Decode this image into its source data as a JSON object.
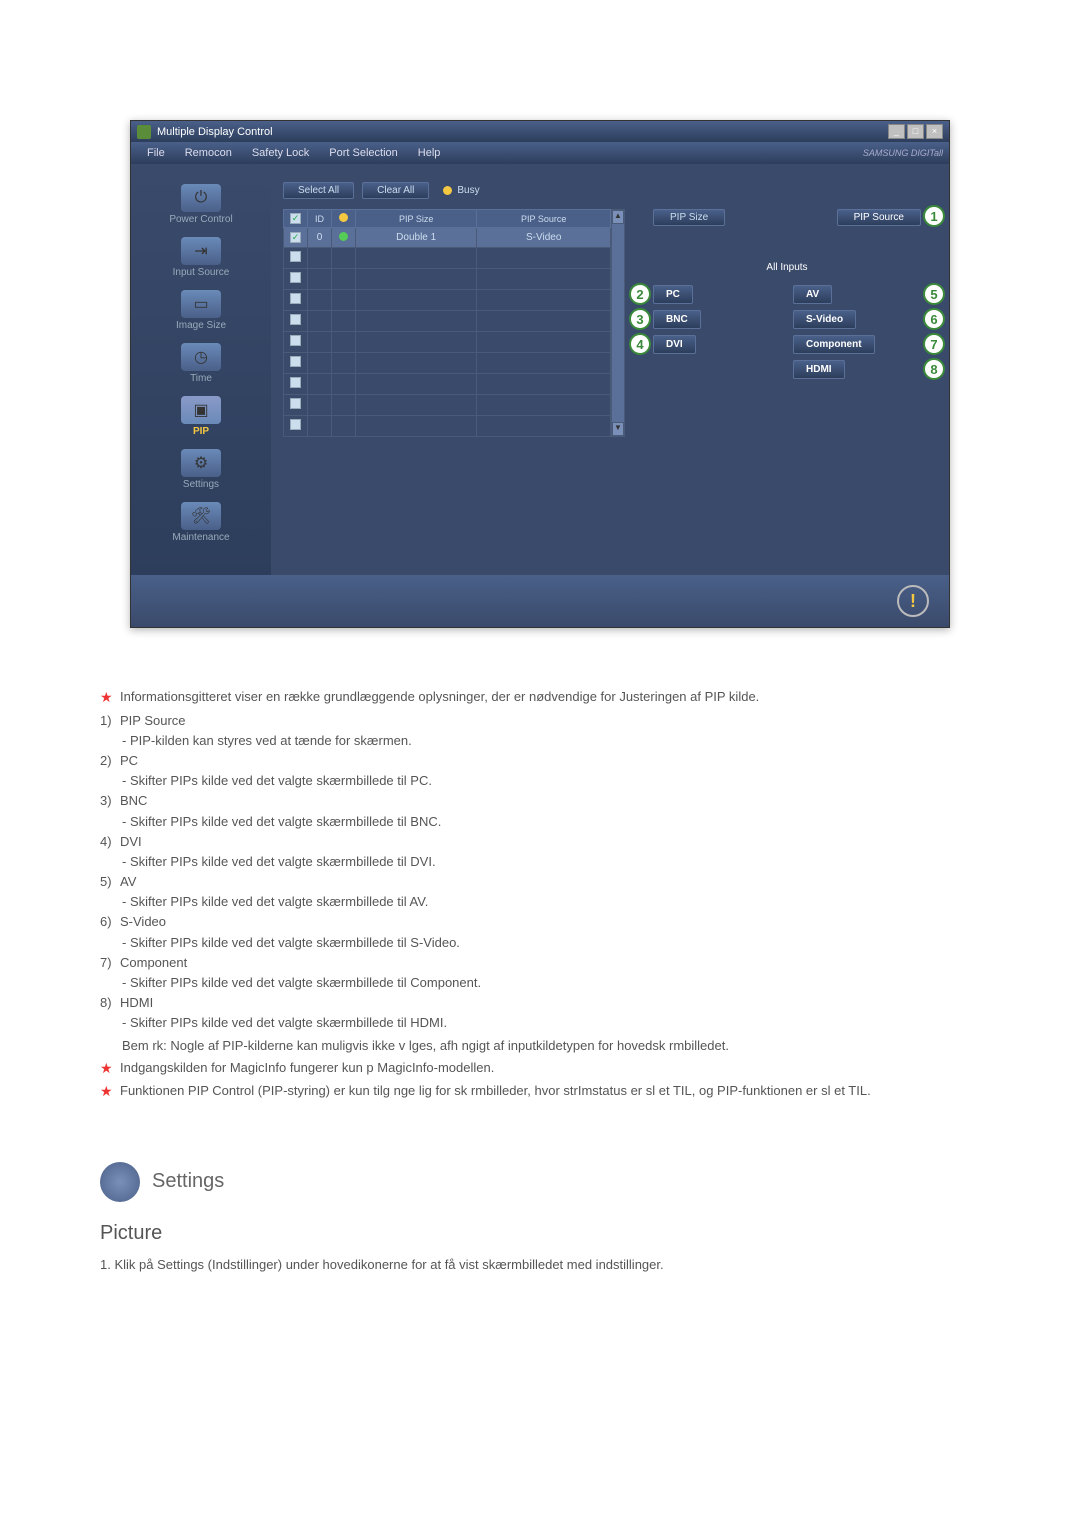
{
  "window": {
    "title": "Multiple Display Control",
    "controls": {
      "minimize": "_",
      "maximize": "□",
      "close": "×"
    }
  },
  "menubar": {
    "items": [
      "File",
      "Remocon",
      "Safety Lock",
      "Port Selection",
      "Help"
    ],
    "logo": "SAMSUNG DIGITall"
  },
  "sidebar": {
    "items": [
      {
        "label": "Power Control",
        "active": false
      },
      {
        "label": "Input Source",
        "active": false
      },
      {
        "label": "Image Size",
        "active": false
      },
      {
        "label": "Time",
        "active": false
      },
      {
        "label": "PIP",
        "active": true
      },
      {
        "label": "Settings",
        "active": false
      },
      {
        "label": "Maintenance",
        "active": false
      }
    ]
  },
  "toolbar": {
    "select_all": "Select All",
    "clear_all": "Clear All",
    "busy": "Busy"
  },
  "table": {
    "headers": {
      "check": "✓",
      "id": "ID",
      "status": "",
      "pip_size": "PIP Size",
      "pip_source": "PIP Source"
    },
    "row0": {
      "id": "0",
      "pip_size": "Double 1",
      "pip_source": "S-Video"
    }
  },
  "panel": {
    "pip_size_btn": "PIP Size",
    "pip_source_btn": "PIP Source",
    "all_inputs": "All Inputs",
    "inputs": {
      "pc": "PC",
      "av": "AV",
      "bnc": "BNC",
      "svideo": "S-Video",
      "dvi": "DVI",
      "component": "Component",
      "hdmi": "HDMI"
    }
  },
  "callouts": {
    "c1": "1",
    "c2": "2",
    "c3": "3",
    "c4": "4",
    "c5": "5",
    "c6": "6",
    "c7": "7",
    "c8": "8"
  },
  "doc": {
    "intro_note": "Informationsgitteret viser en række grundlæggende oplysninger, der er nødvendige for Justeringen af PIP kilde.",
    "items": [
      {
        "num": "1)",
        "title": "PIP Source",
        "desc": "- PIP-kilden kan styres ved at tænde for skærmen."
      },
      {
        "num": "2)",
        "title": "PC",
        "desc": "- Skifter PIPs kilde ved det valgte skærmbillede til PC."
      },
      {
        "num": "3)",
        "title": "BNC",
        "desc": "- Skifter PIPs kilde ved det valgte skærmbillede til BNC."
      },
      {
        "num": "4)",
        "title": "DVI",
        "desc": "- Skifter PIPs kilde ved det valgte skærmbillede til DVI."
      },
      {
        "num": "5)",
        "title": "AV",
        "desc": "- Skifter PIPs kilde ved det valgte skærmbillede til AV."
      },
      {
        "num": "6)",
        "title": "S-Video",
        "desc": "- Skifter PIPs kilde ved det valgte skærmbillede til S-Video."
      },
      {
        "num": "7)",
        "title": "Component",
        "desc": "- Skifter PIPs kilde ved det valgte skærmbillede til Component."
      },
      {
        "num": "8)",
        "title": "HDMI",
        "desc": "- Skifter PIPs kilde ved det valgte skærmbillede til HDMI."
      }
    ],
    "note1": "Bem rk: Nogle af PIP-kilderne kan muligvis ikke v lges, afh ngigt af inputkildetypen for hovedsk rmbilledet.",
    "note2": "Indgangskilden for MagicInfo fungerer kun p  MagicInfo-modellen.",
    "note3": "Funktionen PIP Control (PIP-styring) er kun tilg nge        lig for sk rmbilleder, hvor strImstatus er sl et TIL, og PIP-funktionen er sl et TIL."
  },
  "section": {
    "settings": "Settings",
    "picture": "Picture",
    "picture_step": "1. Klik på Settings (Indstillinger) under hovedikonerne for at få vist skærmbilledet med indstillinger."
  }
}
